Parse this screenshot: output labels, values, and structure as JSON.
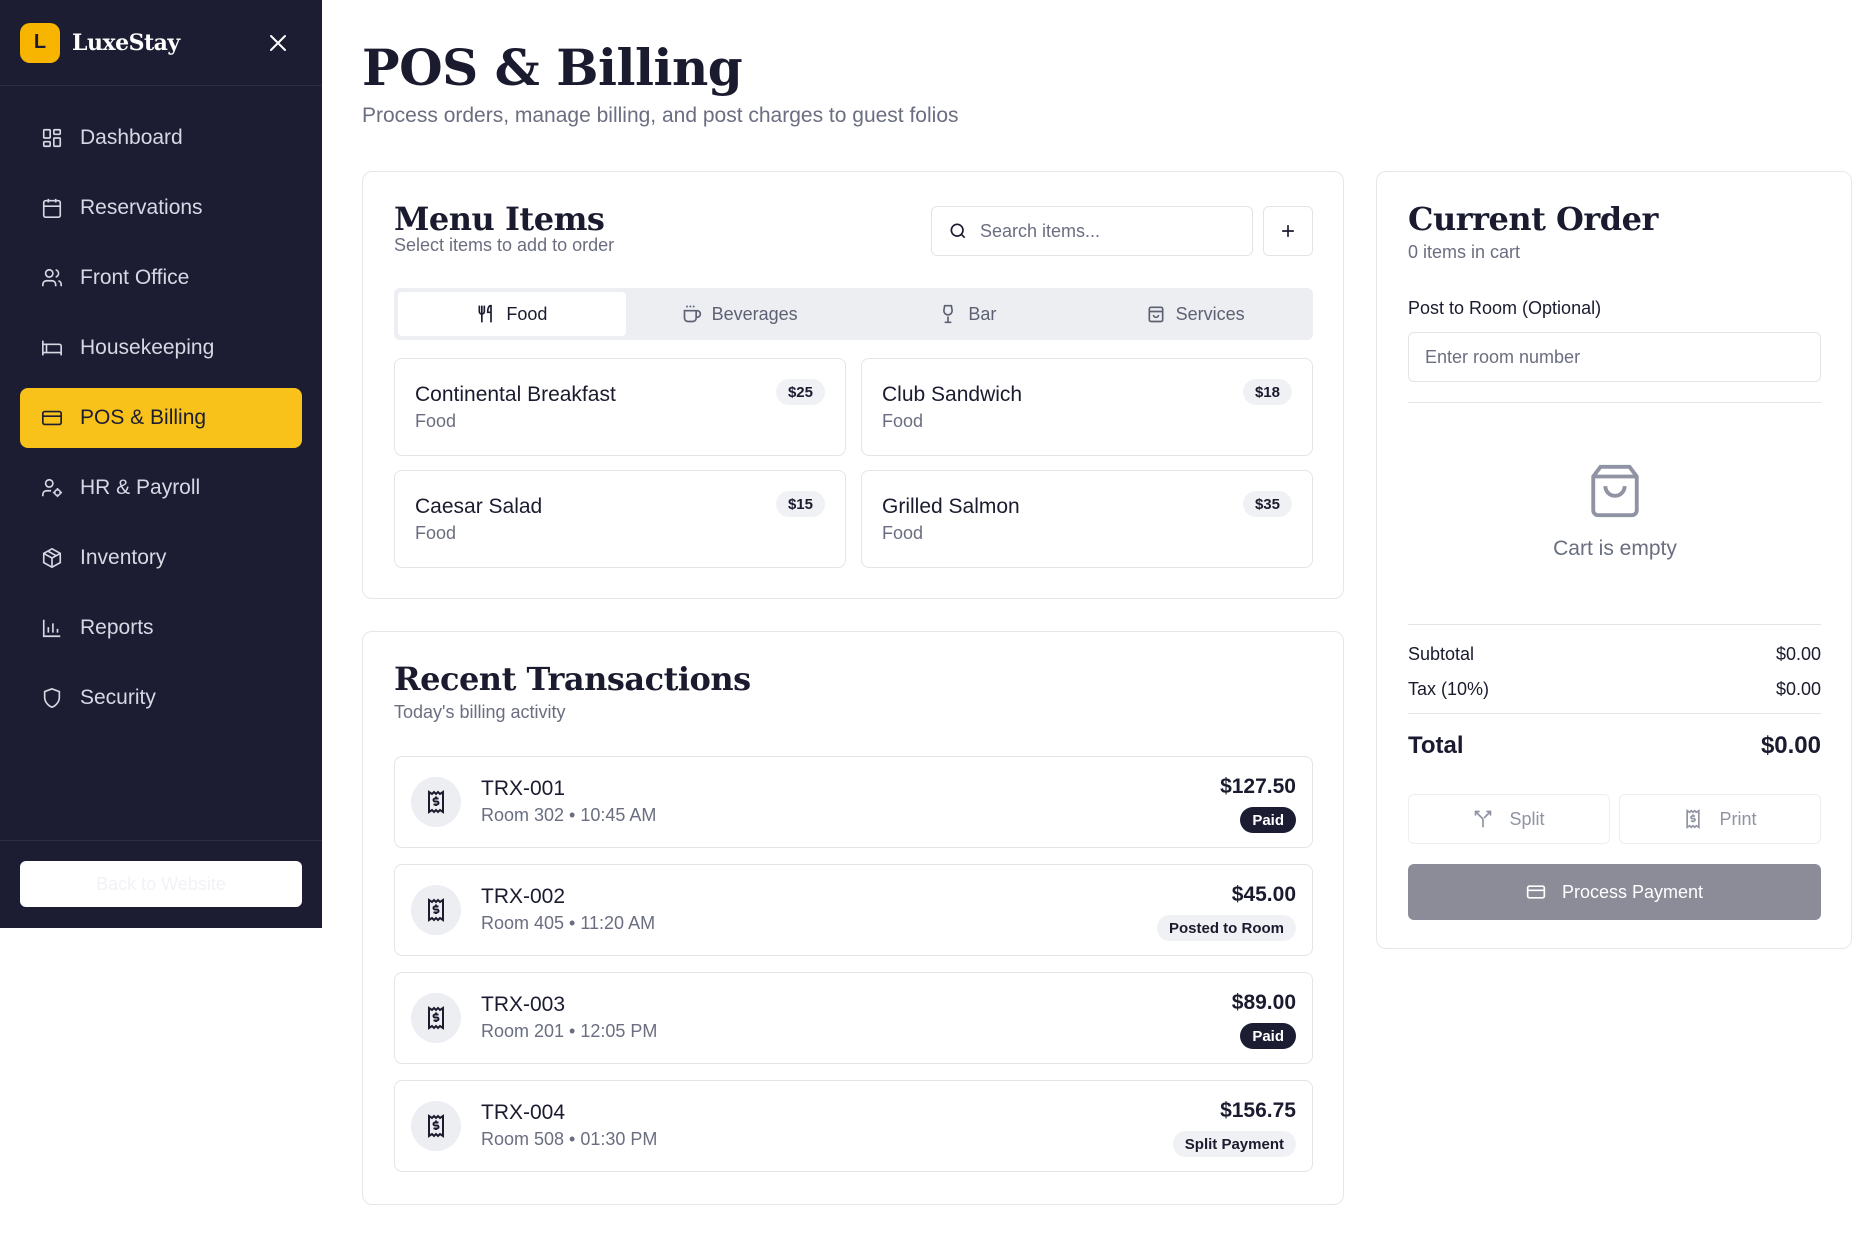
{
  "sidebar": {
    "logo_letter": "L",
    "brand": "LuxeStay",
    "items": [
      {
        "label": "Dashboard",
        "icon": "dashboard-icon"
      },
      {
        "label": "Reservations",
        "icon": "calendar-icon"
      },
      {
        "label": "Front Office",
        "icon": "users-icon"
      },
      {
        "label": "Housekeeping",
        "icon": "bed-icon"
      },
      {
        "label": "POS & Billing",
        "icon": "credit-card-icon",
        "active": true
      },
      {
        "label": "HR & Payroll",
        "icon": "user-cog-icon"
      },
      {
        "label": "Inventory",
        "icon": "package-icon"
      },
      {
        "label": "Reports",
        "icon": "bar-chart-icon"
      },
      {
        "label": "Security",
        "icon": "shield-icon"
      }
    ],
    "back_label": "Back to Website"
  },
  "header": {
    "title": "POS & Billing",
    "subtitle": "Process orders, manage billing, and post charges to guest folios"
  },
  "menu": {
    "title": "Menu Items",
    "subtitle": "Select items to add to order",
    "search_placeholder": "Search items...",
    "tabs": [
      {
        "label": "Food",
        "icon": "utensils-icon",
        "active": true
      },
      {
        "label": "Beverages",
        "icon": "coffee-icon"
      },
      {
        "label": "Bar",
        "icon": "wine-icon"
      },
      {
        "label": "Services",
        "icon": "bag-icon"
      }
    ],
    "items": [
      {
        "name": "Continental Breakfast",
        "category": "Food",
        "price": "$25"
      },
      {
        "name": "Club Sandwich",
        "category": "Food",
        "price": "$18"
      },
      {
        "name": "Caesar Salad",
        "category": "Food",
        "price": "$15"
      },
      {
        "name": "Grilled Salmon",
        "category": "Food",
        "price": "$35"
      }
    ]
  },
  "transactions": {
    "title": "Recent Transactions",
    "subtitle": "Today's billing activity",
    "rows": [
      {
        "id": "TRX-001",
        "meta": "Room 302 • 10:45 AM",
        "amount": "$127.50",
        "status": "Paid"
      },
      {
        "id": "TRX-002",
        "meta": "Room 405 • 11:20 AM",
        "amount": "$45.00",
        "status": "Posted to Room"
      },
      {
        "id": "TRX-003",
        "meta": "Room 201 • 12:05 PM",
        "amount": "$89.00",
        "status": "Paid"
      },
      {
        "id": "TRX-004",
        "meta": "Room 508 • 01:30 PM",
        "amount": "$156.75",
        "status": "Split Payment"
      }
    ]
  },
  "order": {
    "title": "Current Order",
    "count_text": "0 items in cart",
    "room_label": "Post to Room (Optional)",
    "room_placeholder": "Enter room number",
    "empty_text": "Cart is empty",
    "subtotal_label": "Subtotal",
    "subtotal_value": "$0.00",
    "tax_label": "Tax (10%)",
    "tax_value": "$0.00",
    "total_label": "Total",
    "total_value": "$0.00",
    "split_label": "Split",
    "print_label": "Print",
    "pay_label": "Process Payment"
  },
  "colors": {
    "sidebar_bg": "#1c1d33",
    "accent": "#f8c21a",
    "badge_dark": "#1c1d33",
    "pay_disabled": "#8b8c98"
  }
}
